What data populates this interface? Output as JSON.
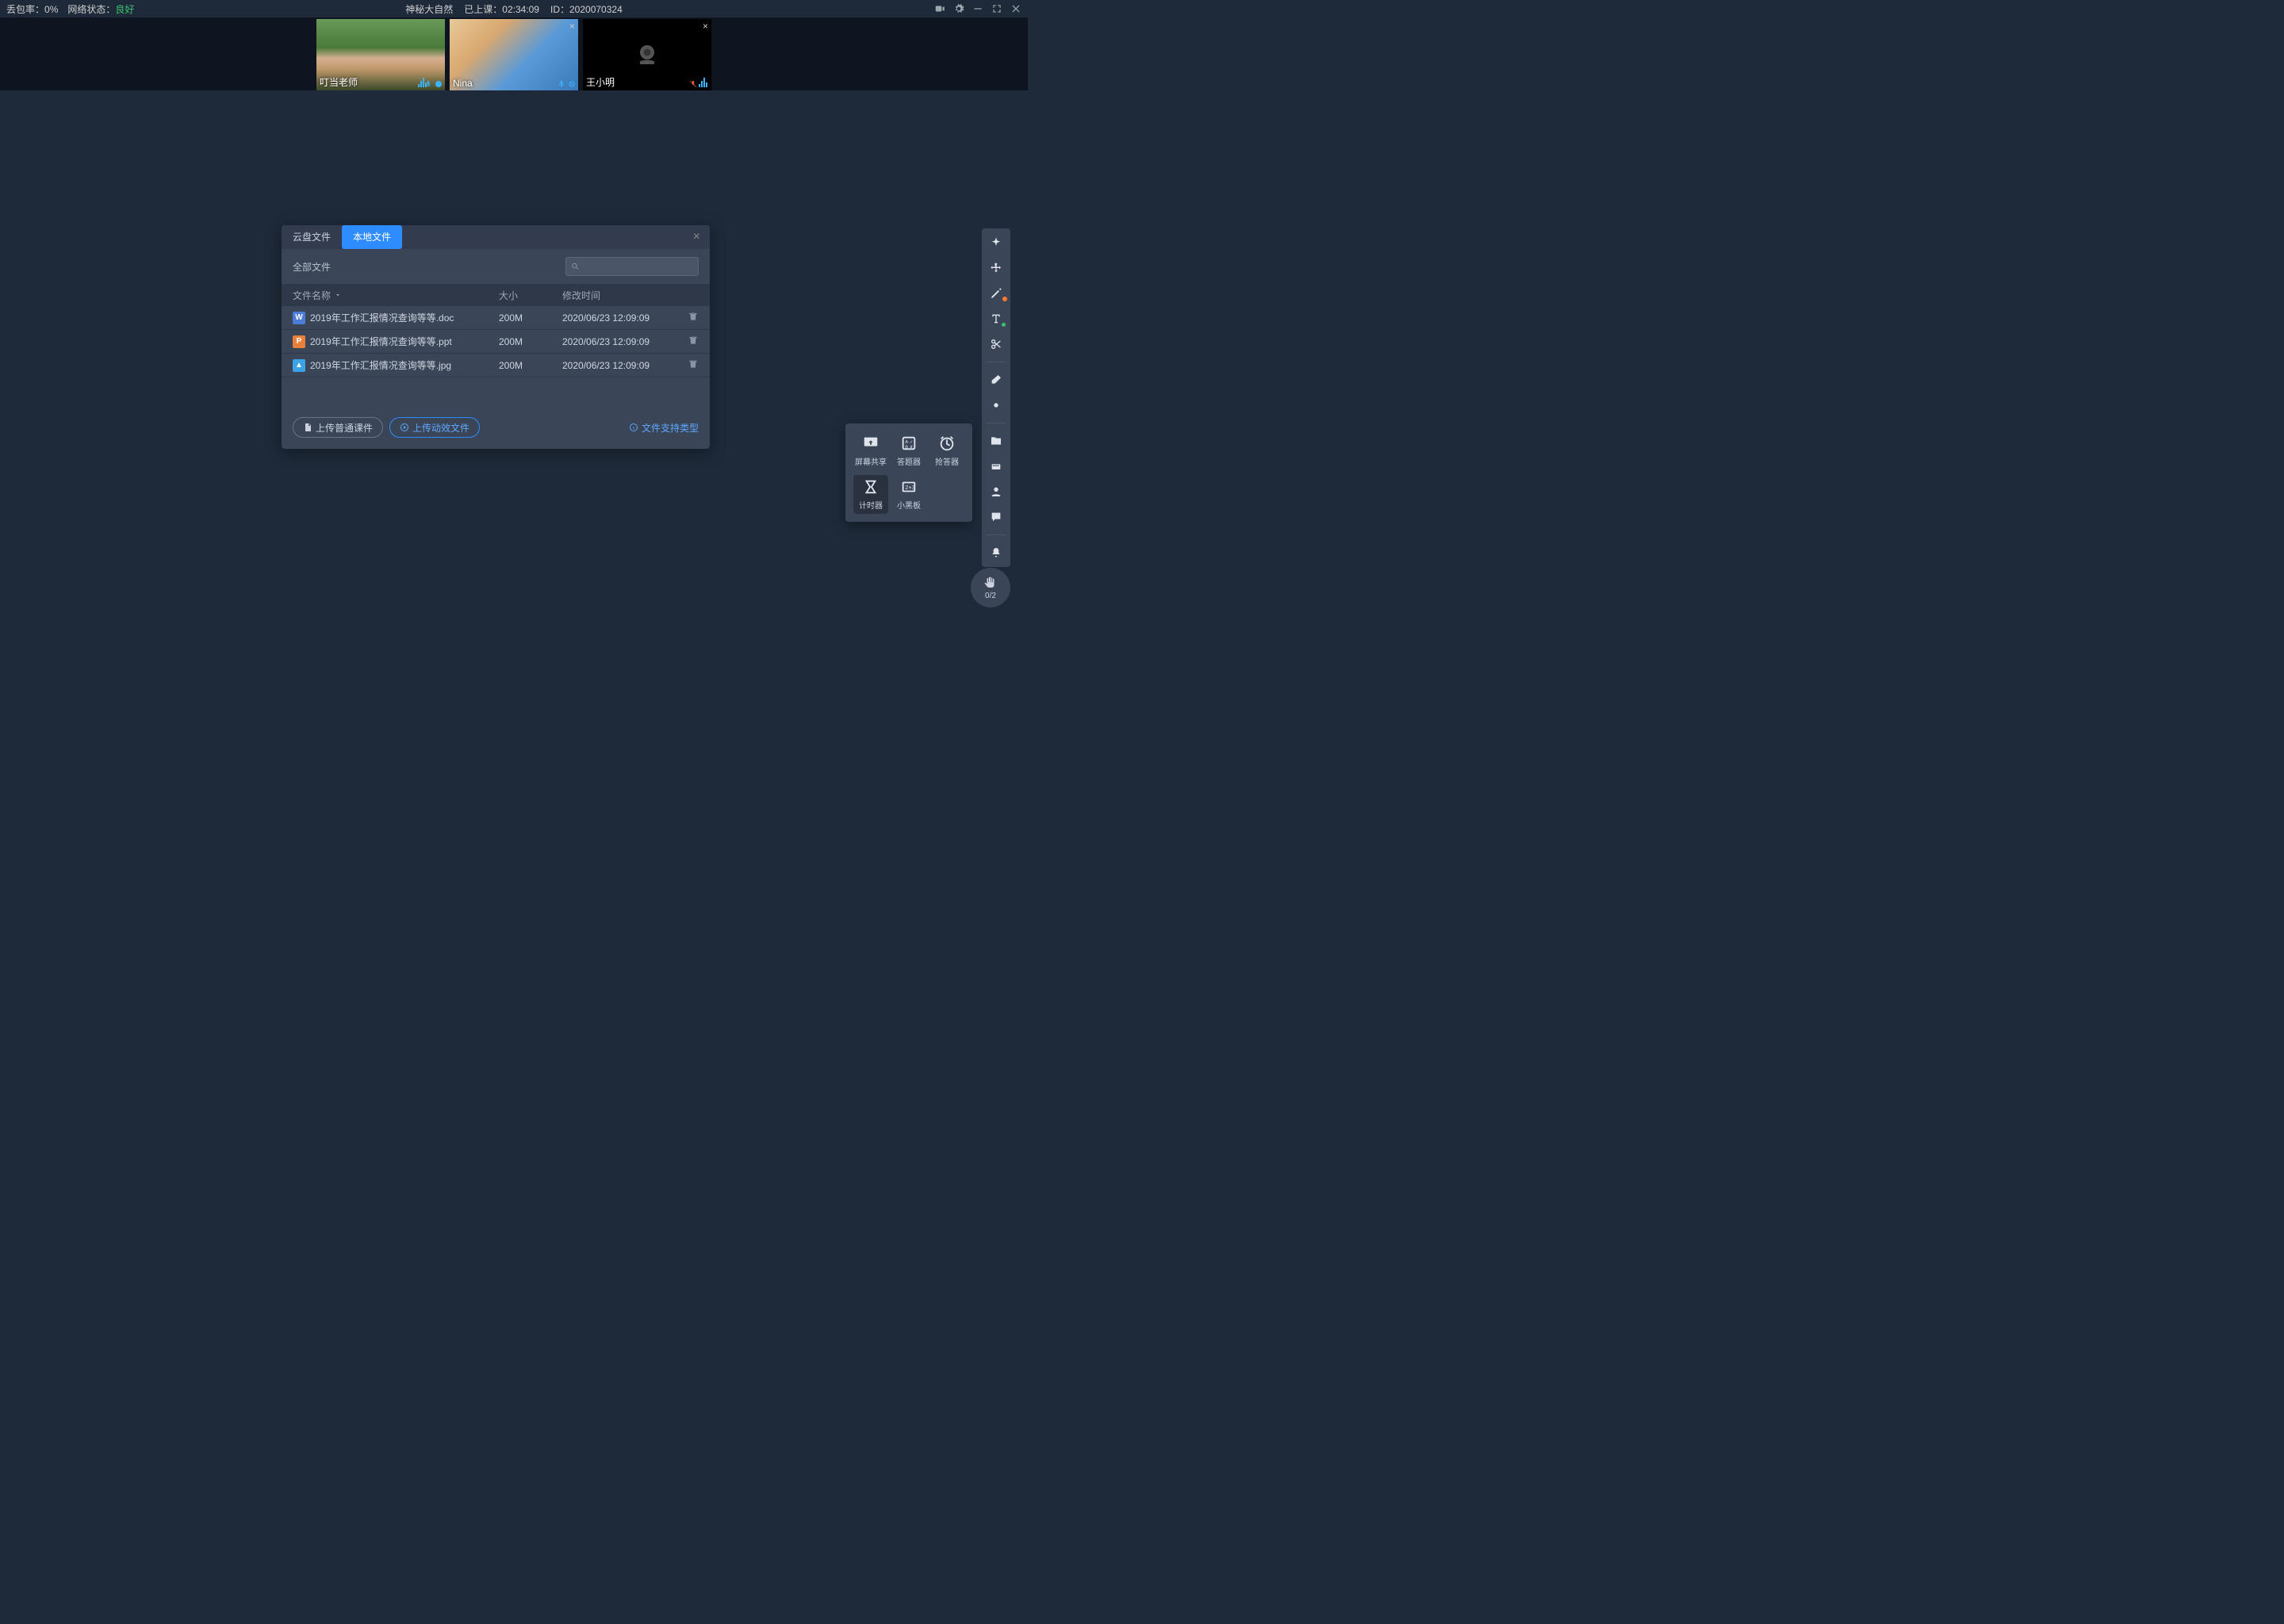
{
  "topbar": {
    "packet_loss_label": "丢包率：",
    "packet_loss_value": "0%",
    "network_label": "网络状态：",
    "network_value": "良好",
    "course_name": "神秘大自然",
    "duration_label": "已上课：",
    "duration_value": "02:34:09",
    "id_label": "ID：",
    "id_value": "2020070324"
  },
  "participants": [
    {
      "name": "叮当老师"
    },
    {
      "name": "Nina"
    },
    {
      "name": "王小明"
    }
  ],
  "dialog": {
    "tab_cloud": "云盘文件",
    "tab_local": "本地文件",
    "subtitle": "全部文件",
    "hdr_name": "文件名称",
    "hdr_size": "大小",
    "hdr_time": "修改时间",
    "files": [
      {
        "type": "W",
        "name": "2019年工作汇报情况查询等等.doc",
        "size": "200M",
        "time": "2020/06/23 12:09:09"
      },
      {
        "type": "P",
        "name": "2019年工作汇报情况查询等等.ppt",
        "size": "200M",
        "time": "2020/06/23 12:09:09"
      },
      {
        "type": "I",
        "name": "2019年工作汇报情况查询等等.jpg",
        "size": "200M",
        "time": "2020/06/23 12:09:09"
      }
    ],
    "btn_upload_normal": "上传普通课件",
    "btn_upload_anim": "上传动效文件",
    "support_link": "文件支持类型"
  },
  "tool_popup": {
    "items": [
      "屏幕共享",
      "答题器",
      "抢答器",
      "计时器",
      "小黑板"
    ]
  },
  "hand": {
    "count": "0/2"
  }
}
